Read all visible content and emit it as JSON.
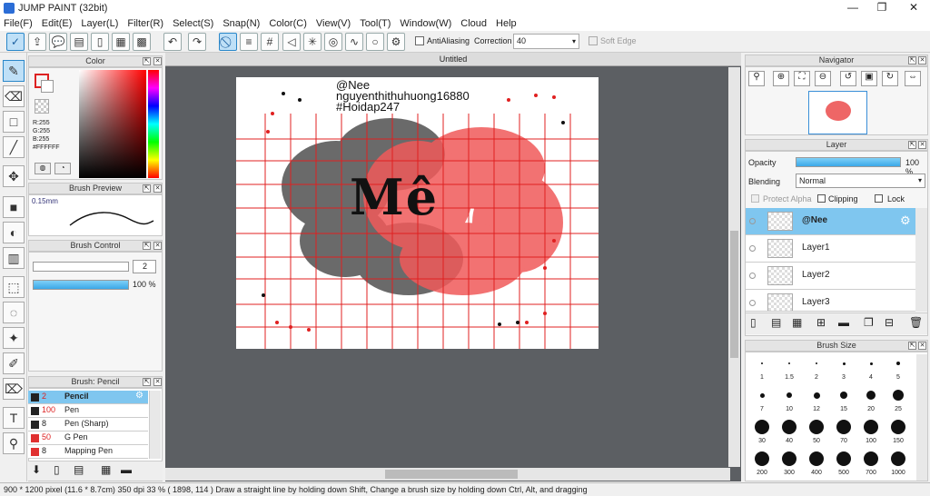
{
  "window": {
    "title": "JUMP PAINT (32bit)",
    "min": "—",
    "max": "❐",
    "close": "✕"
  },
  "menu": [
    "File(F)",
    "Edit(E)",
    "Layer(L)",
    "Filter(R)",
    "Select(S)",
    "Snap(N)",
    "Color(C)",
    "View(V)",
    "Tool(T)",
    "Window(W)",
    "Cloud",
    "Help"
  ],
  "toolbar": {
    "antialiasing_label": "AntiAliasing",
    "correction_label": "Correction",
    "correction_value": "40",
    "soft_edge_label": "Soft Edge"
  },
  "color_panel": {
    "title": "Color",
    "r": "R:255",
    "g": "G:255",
    "b": "B:255",
    "hex": "#FFFFFF",
    "primary": "#ffffff",
    "secondary": "#ffffff"
  },
  "brush_preview": {
    "title": "Brush Preview",
    "size": "0.15mm"
  },
  "brush_control": {
    "title": "Brush Control",
    "size_value": "2",
    "opacity_value": "100 %",
    "opacity_fraction": 1.0
  },
  "brush_list": {
    "title": "Brush: Pencil",
    "items": [
      {
        "num": "2",
        "name": "Pencil",
        "color": "#222222",
        "selected": true
      },
      {
        "num": "100",
        "name": "Pen",
        "color": "#222222",
        "selected": false
      },
      {
        "num": "8",
        "name": "Pen (Sharp)",
        "color": "#222222",
        "selected": false
      },
      {
        "num": "50",
        "name": "G Pen",
        "color": "#e03030",
        "selected": false
      },
      {
        "num": "8",
        "name": "Mapping Pen",
        "color": "#e03030",
        "selected": false
      }
    ]
  },
  "document": {
    "tab": "Untitled",
    "watermark": [
      "@Nee",
      "nguyenthithuhuong16880",
      "#Hoidap247"
    ],
    "title_text": "Mê"
  },
  "navigator": {
    "title": "Navigator"
  },
  "layer_panel": {
    "title": "Layer",
    "opacity_label": "Opacity",
    "opacity_value": "100 %",
    "blending_label": "Blending",
    "blending_value": "Normal",
    "protect_alpha": "Protect Alpha",
    "clipping": "Clipping",
    "lock": "Lock",
    "layers": [
      {
        "name": "@Nee",
        "selected": true
      },
      {
        "name": "Layer1",
        "selected": false
      },
      {
        "name": "Layer2",
        "selected": false
      },
      {
        "name": "Layer3",
        "selected": false
      }
    ]
  },
  "brush_size": {
    "title": "Brush Size",
    "sizes": [
      "1",
      "1.5",
      "2",
      "3",
      "4",
      "5",
      "7",
      "10",
      "12",
      "15",
      "20",
      "25",
      "30",
      "40",
      "50",
      "70",
      "100",
      "150",
      "200",
      "300",
      "400",
      "500",
      "700",
      "1000"
    ]
  },
  "status": {
    "dims": "900 * 1200 pixel",
    "physical": "(11.6 * 8.7cm)",
    "dpi": "350 dpi",
    "zoom": "33 %",
    "coords": "( 1898, 114 )",
    "hint": "Draw a straight line by holding down Shift, Change a brush size by holding down Ctrl, Alt, and dragging"
  }
}
